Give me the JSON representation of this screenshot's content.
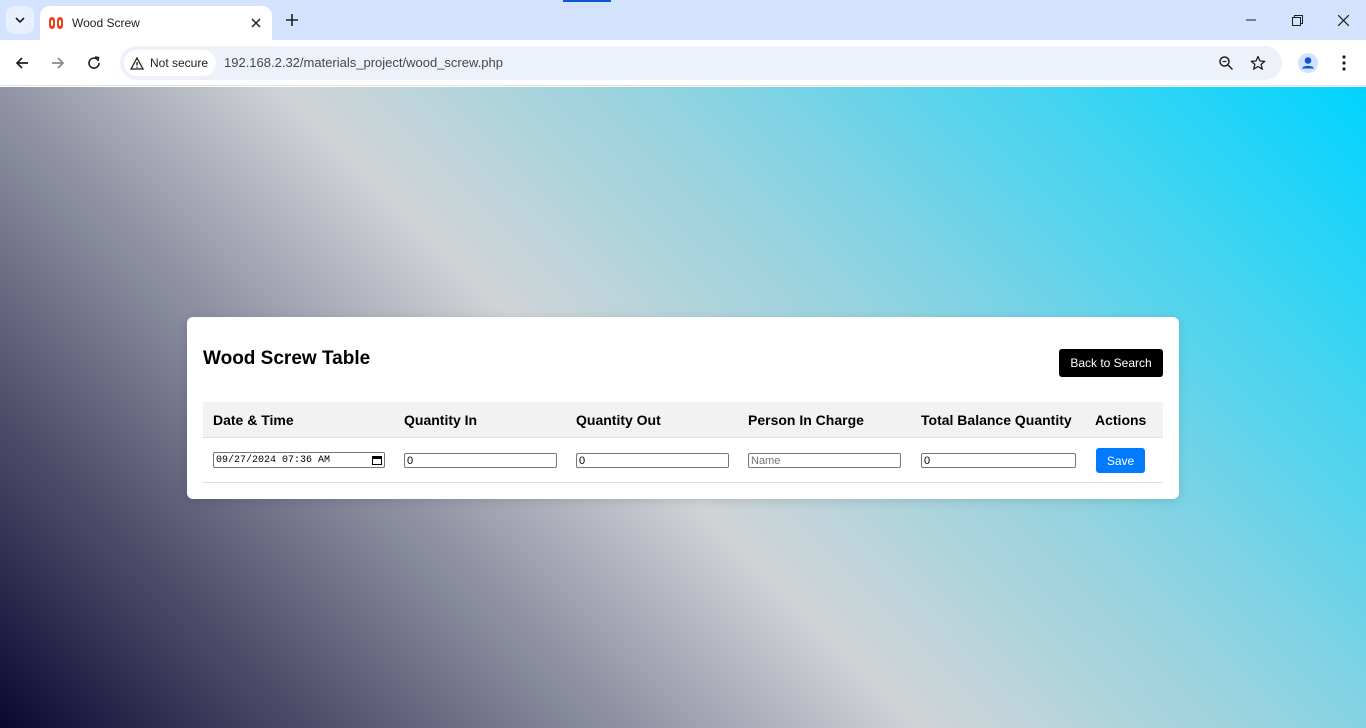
{
  "browser": {
    "tab_title": "Wood Screw",
    "security_label": "Not secure",
    "url": "192.168.2.32/materials_project/wood_screw.php"
  },
  "page": {
    "title": "Wood Screw Table",
    "back_button": "Back to Search",
    "columns": [
      "Date & Time",
      "Quantity In",
      "Quantity Out",
      "Person In Charge",
      "Total Balance Quantity",
      "Actions"
    ],
    "row": {
      "datetime": "09/27/2024 07:36 AM",
      "quantity_in": "0",
      "quantity_out": "0",
      "person_placeholder": "Name",
      "total_balance": "0",
      "save_button": "Save"
    }
  },
  "colors": {
    "accent": "#007bff",
    "back_button_bg": "#000000",
    "tabstrip": "#d3e3fd"
  }
}
